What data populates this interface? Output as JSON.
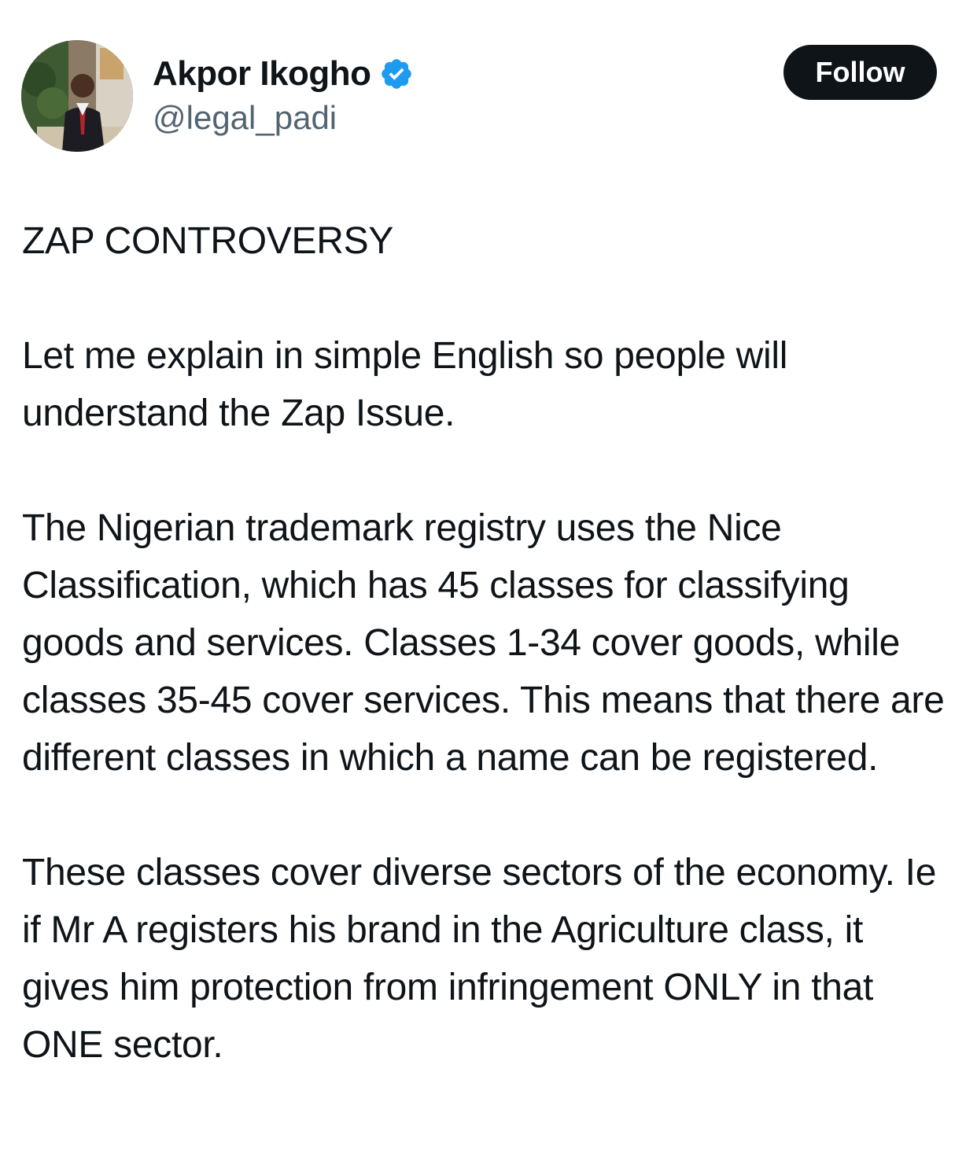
{
  "author": {
    "display_name": "Akpor Ikogho",
    "handle": "@legal_padi",
    "verified": true,
    "avatar_icon": "profile-photo"
  },
  "actions": {
    "follow_label": "Follow"
  },
  "tweet": {
    "title": "ZAP CONTROVERSY",
    "paragraphs": [
      "Let me explain in simple English so people will understand the Zap Issue.",
      "The Nigerian trademark registry uses the Nice Classification, which has 45 classes for classifying goods and services. Classes 1-34 cover goods, while classes 35-45 cover services. This means that there are different classes in which a name can be registered.",
      "These classes cover diverse sectors of the economy. Ie if Mr A registers his brand in the Agriculture class, it gives him protection from infringement ONLY in that ONE sector."
    ]
  },
  "colors": {
    "text": "#0f1419",
    "secondary_text": "#536471",
    "verified_badge": "#1d9bf0",
    "follow_button_bg": "#0f1419",
    "follow_button_text": "#ffffff"
  }
}
